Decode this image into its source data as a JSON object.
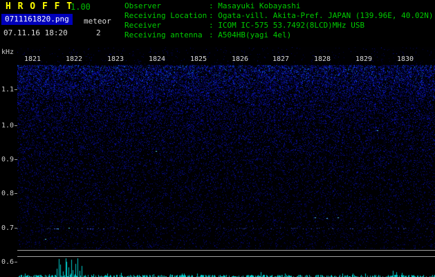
{
  "app": {
    "title": "H R O F F T",
    "version": "1.00"
  },
  "header": {
    "filename": "0711161820.png",
    "datetime": "07.11.16 18:20",
    "meteor_label": "meteor",
    "meteor_count": "2",
    "info": [
      {
        "label": "Observer",
        "value": ": Masayuki Kobayashi"
      },
      {
        "label": "Receiving Location",
        "value": ": Ogata-vill. Akita-Pref. JAPAN (139.96E, 40.02N)"
      },
      {
        "label": "Receiver",
        "value": ": ICOM IC-575 53.7492(8LCD)MHz USB"
      },
      {
        "label": "Receiving antenna",
        "value": ": A504HB(yagi 4el)"
      }
    ]
  },
  "spectrogram": {
    "unit_label": "kHz",
    "time_labels": [
      "1821",
      "1822",
      "1823",
      "1824",
      "1825",
      "1826",
      "1827",
      "1828",
      "1829",
      "1830"
    ],
    "freq_labels": [
      "1.1",
      "1.0",
      "0.9",
      "0.8",
      "0.7",
      "0.6"
    ]
  },
  "colors": {
    "title_yellow": "#ffff00",
    "version_green": "#00bb00",
    "info_green": "#00cc00",
    "filename_box_blue": "#0000bb",
    "axis_text_grey": "#cccccc",
    "noise_blue": "#2020e0",
    "spike_cyan": "#00cccc",
    "separator_grey": "#a0a0a0"
  },
  "chart_data": [
    {
      "type": "heatmap",
      "title": "",
      "xlabel": "",
      "ylabel": "kHz",
      "x_tick_labels": [
        "1821",
        "1822",
        "1823",
        "1824",
        "1825",
        "1826",
        "1827",
        "1828",
        "1829",
        "1830"
      ],
      "y_tick_labels": [
        "1.1",
        "1.0",
        "0.9",
        "0.8",
        "0.7",
        "0.6"
      ],
      "ylim": [
        0.55,
        1.2
      ],
      "grid": "off",
      "legend": "off",
      "content": "10-minute radio spectrogram of background noise; blue speckle densest and brightest near the top (above ~1.05 kHz) fading toward lower frequencies; faint sparse dotted trace near 0.7 kHz; meteor echo count shown in header is 2"
    },
    {
      "type": "bar",
      "title": "",
      "xlabel": "",
      "ylabel": "",
      "content": "bottom signal-level strip: small cyan spikes (1-4 px) across the entire 1821-1830 span with one burst of tall spikes shortly after 1821"
    }
  ]
}
